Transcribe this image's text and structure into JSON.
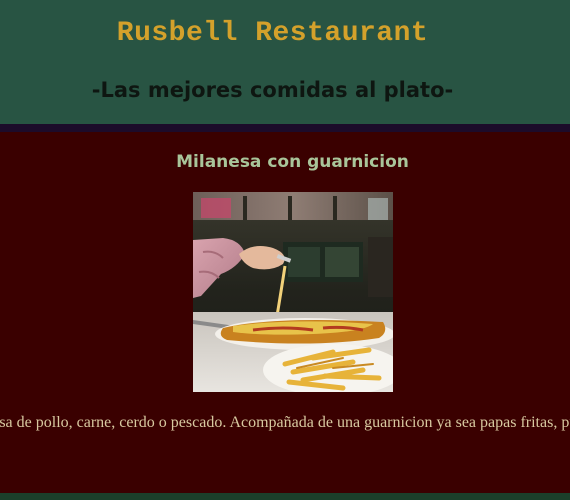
{
  "header": {
    "title": "Rusbell Restaurant",
    "tagline": "-Las mejores comidas al plato-"
  },
  "dish": {
    "name": "Milanesa con guarnicion",
    "description": "Milanesa de pollo, carne, cerdo o pescado. Acompañada de una guarnicion ya sea papas fritas, pure o ensalada."
  },
  "colors": {
    "header_bg": "#285443",
    "title": "#d4a12b",
    "tagline": "#0e1611",
    "body_bg": "#3a0000",
    "dish_title": "#a9c59a",
    "description": "#d8c9a0"
  }
}
